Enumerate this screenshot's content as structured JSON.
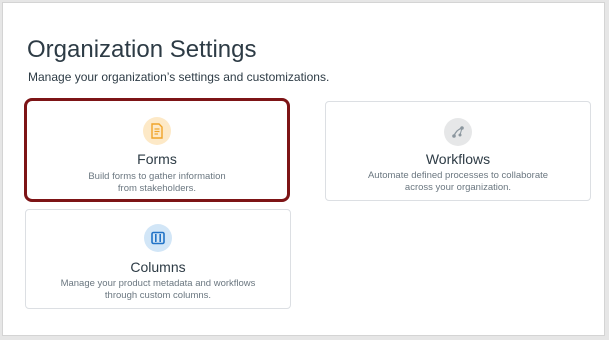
{
  "page": {
    "title": "Organization Settings",
    "subtitle": "Manage your organization’s settings and customizations."
  },
  "cards": [
    {
      "title": "Forms",
      "desc_lines": [
        "Build forms to gather information",
        "from stakeholders."
      ],
      "icon": "form-document-icon",
      "icon_bg": "#fde9c7",
      "icon_color": "#f0a429",
      "selected": true
    },
    {
      "title": "Workflows",
      "desc_lines": [
        "Automate defined processes to collaborate",
        "across your organization."
      ],
      "icon": "workflow-branch-icon",
      "icon_bg": "#e6e7e8",
      "icon_color": "#8b969e",
      "selected": false
    },
    {
      "title": "Columns",
      "desc_lines": [
        "Manage your product metadata and workflows",
        "through custom columns."
      ],
      "icon": "columns-icon",
      "icon_bg": "#d2e6f7",
      "icon_color": "#2173c7",
      "selected": false
    }
  ],
  "colors": {
    "selected_border": "#7d1416",
    "text": "#2d3b45",
    "muted": "#6b7780"
  }
}
